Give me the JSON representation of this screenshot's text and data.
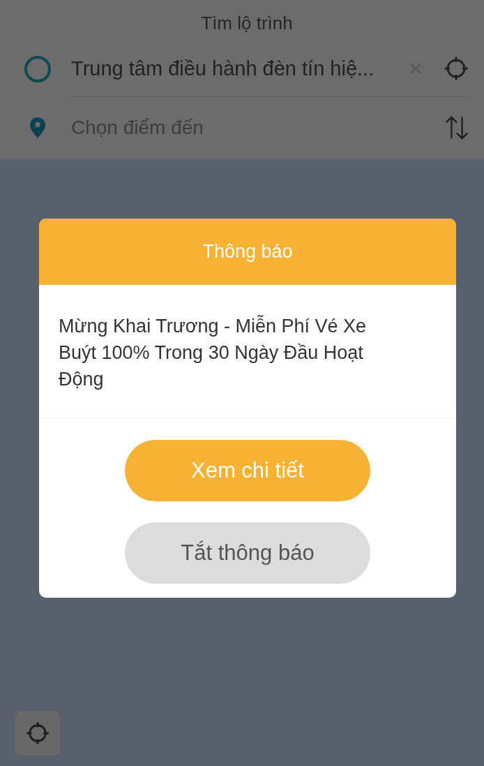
{
  "header": {
    "title": "Tìm lộ trình"
  },
  "route": {
    "origin": {
      "value": "Trung tâm điều hành đèn tín hiệ..."
    },
    "destination": {
      "placeholder": "Chọn điểm đến"
    }
  },
  "dialog": {
    "title": "Thông báo",
    "message": "Mừng Khai Trương - Miễn Phí Vé Xe Buýt 100% Trong 30 Ngày Đầu Hoạt Động",
    "buttons": [
      {
        "label": "Xem chi tiết",
        "kind": "primary"
      },
      {
        "label": "Tắt thông báo",
        "kind": "secondary"
      }
    ]
  }
}
